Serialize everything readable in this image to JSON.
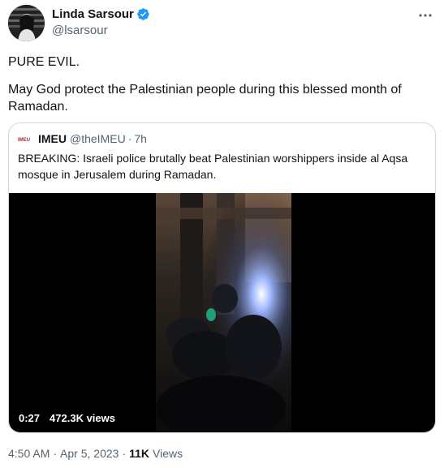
{
  "tweet": {
    "author_name": "Linda Sarsour",
    "author_handle": "@lsarsour",
    "text_line1": "PURE EVIL.",
    "text_line2": "May God protect the Palestinian people during this blessed month of Ramadan.",
    "more_icon": "more-horizontal-icon",
    "verified_icon": "verified-badge-icon",
    "verified_color": "#1d9bf0"
  },
  "quoted_tweet": {
    "logo_text": "IMEU",
    "author_name": "IMEU",
    "author_handle": "@theIMEU",
    "separator": "·",
    "time": "7h",
    "text": "BREAKING: Israeli police brutally beat Palestinian worshippers inside al Aqsa mosque in Jerusalem during Ramadan.",
    "video": {
      "duration": "0:27",
      "views": "472.3K views"
    }
  },
  "meta": {
    "time": "4:50 AM",
    "sep1": "·",
    "date": "Apr 5, 2023",
    "sep2": "·",
    "views_count": "11K",
    "views_label": "Views"
  }
}
